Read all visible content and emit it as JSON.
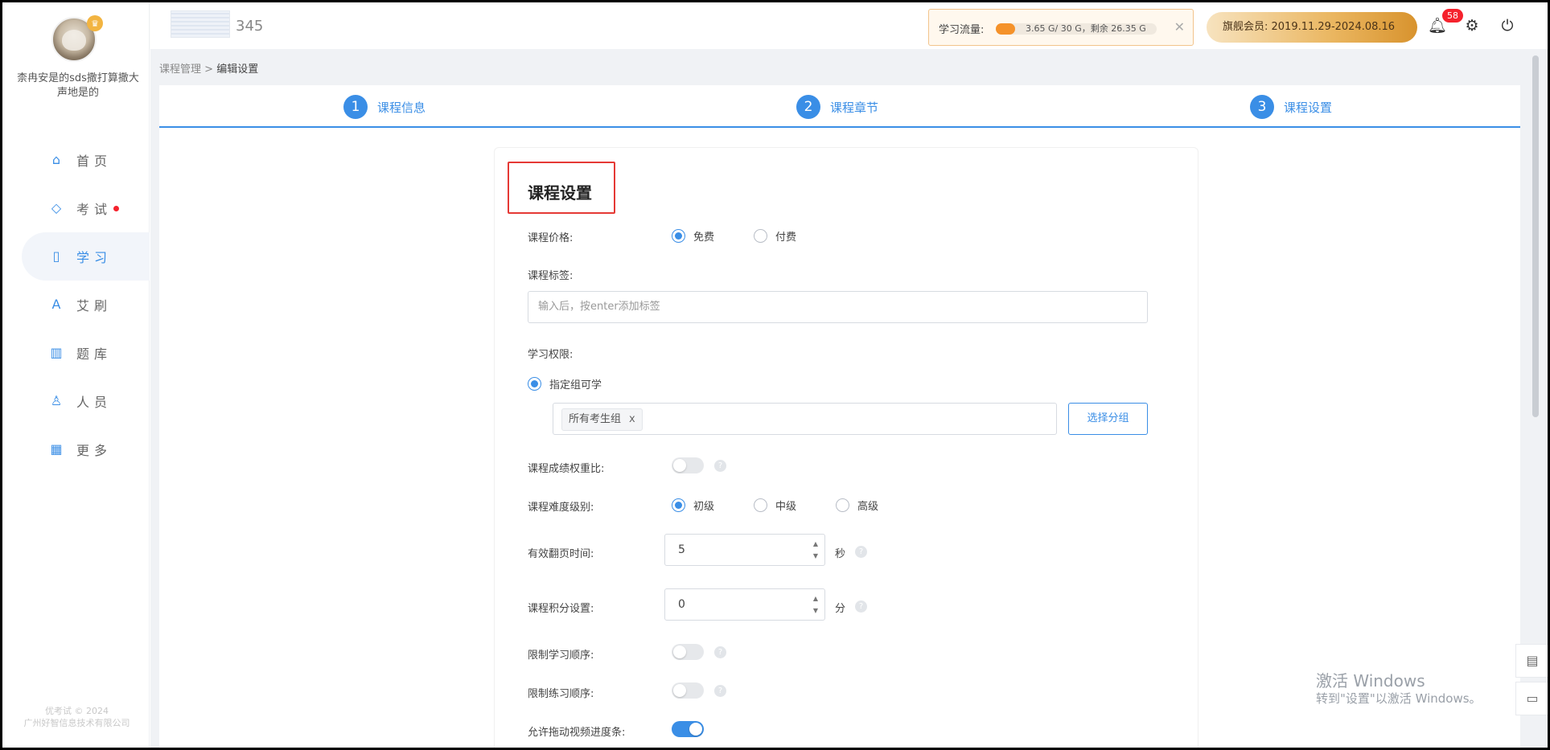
{
  "sidebar": {
    "username": "柰冉安是的sds撒打算撒大声地是的",
    "nav": [
      {
        "label": "首页",
        "icon": "home-icon",
        "glyph": "⌂"
      },
      {
        "label": "考试",
        "icon": "eraser-icon",
        "glyph": "◇"
      },
      {
        "label": "学习",
        "icon": "book-icon",
        "glyph": "▯"
      },
      {
        "label": "艾刷",
        "icon": "letter-a-icon",
        "glyph": "A"
      },
      {
        "label": "题库",
        "icon": "bar-chart-icon",
        "glyph": "▥"
      },
      {
        "label": "人员",
        "icon": "person-icon",
        "glyph": "♙"
      },
      {
        "label": "更多",
        "icon": "apps-icon",
        "glyph": "▦"
      }
    ],
    "active_index": 2,
    "copyright_line1": "优考试 © 2024",
    "copyright_line2": "广州好智信息技术有限公司"
  },
  "topbar": {
    "logo_text": "345",
    "traffic_label": "学习流量:",
    "traffic_text": "3.65 G/ 30 G，剩余 26.35 G",
    "traffic_used_fraction": 0.122,
    "vip_text": "旗舰会员: 2019.11.29-2024.08.16",
    "notification_count": "58",
    "accent": "#3a8ee6",
    "traffic_color": "#f5922a",
    "badge_color": "#f5222d"
  },
  "breadcrumb": {
    "parent": "课程管理",
    "separator": ">",
    "current": "编辑设置"
  },
  "steps": [
    {
      "num": "1",
      "label": "课程信息"
    },
    {
      "num": "2",
      "label": "课程章节"
    },
    {
      "num": "3",
      "label": "课程设置"
    }
  ],
  "form": {
    "title": "课程设置",
    "price_label": "课程价格:",
    "price_free": "免费",
    "price_paid": "付费",
    "tags_label": "课程标签:",
    "tags_placeholder": "输入后，按enter添加标签",
    "permission_label": "学习权限:",
    "permission_option": "指定组可学",
    "group_tag": "所有考生组",
    "group_tag_remove": "x",
    "select_group_button": "选择分组",
    "weight_label": "课程成绩权重比:",
    "difficulty_label": "课程难度级别:",
    "difficulty_options": [
      "初级",
      "中级",
      "高级"
    ],
    "page_time_label": "有效翻页时间:",
    "page_time_value": "5",
    "page_time_unit": "秒",
    "points_label": "课程积分设置:",
    "points_value": "0",
    "points_unit": "分",
    "limit_study_order_label": "限制学习顺序:",
    "limit_practice_order_label": "限制练习顺序:",
    "allow_drag_label": "允许拖动视频进度条:",
    "help_glyph": "?"
  },
  "watermark": {
    "line1": "激活 Windows",
    "line2": "转到\"设置\"以激活 Windows。"
  }
}
